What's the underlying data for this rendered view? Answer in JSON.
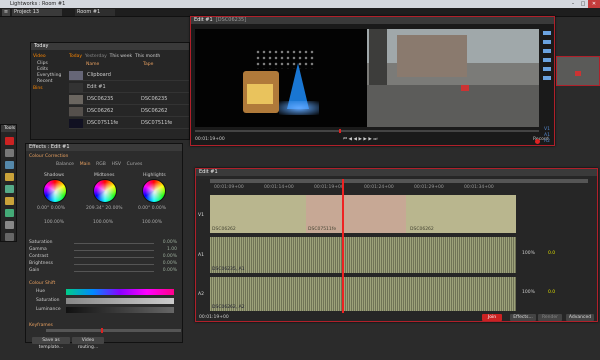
{
  "window": {
    "title": "Lightworks : Room #1",
    "minimize": "–",
    "maximize": "□",
    "close": "✕"
  },
  "project": {
    "name": "Project 13",
    "room": "Room #1"
  },
  "today": {
    "title": "Today",
    "tabs": [
      "Today",
      "Yesterday",
      "This week",
      "This month",
      "Cust..."
    ],
    "filters": [
      "Video",
      "Clips",
      "Edits",
      "Everything",
      "Recent",
      "Bins"
    ],
    "col_name": "Name",
    "col_tape": "Tape",
    "rows": [
      {
        "name": "Clipboard",
        "tape": ""
      },
      {
        "name": "Edit #1",
        "tape": ""
      },
      {
        "name": "DSC06235",
        "tape": "DSC06235"
      },
      {
        "name": "DSC06262",
        "tape": "DSC06262"
      },
      {
        "name": "DSC07511fe",
        "tape": "DSC07511fe"
      }
    ]
  },
  "effects": {
    "title": "Effects : Edit #1",
    "section_colour": "Colour Correction",
    "tabs": [
      "Balance",
      "Main",
      "RGB",
      "HSV",
      "Curves"
    ],
    "wheels": [
      {
        "name": "Shadows",
        "vals": "0.00°   0.00%",
        "pct": "100.00%"
      },
      {
        "name": "Midtones",
        "vals": "209.34°  20.00%",
        "pct": "100.00%"
      },
      {
        "name": "Highlights",
        "vals": "0.00°   0.00%",
        "pct": "100.00%"
      }
    ],
    "sliders": [
      {
        "name": "Saturation",
        "val": "0.00%"
      },
      {
        "name": "Gamma",
        "val": "1.00"
      },
      {
        "name": "Contrast",
        "val": "0.00%"
      },
      {
        "name": "Brightness",
        "val": "0.00%"
      },
      {
        "name": "Gain",
        "val": "0.00%"
      }
    ],
    "section_huesat": "Colour Shift",
    "hue_rows": [
      "Hue",
      "Saturation",
      "Luminance"
    ],
    "keyframes_label": "Keyframes",
    "save_template": "Save as template...",
    "video_routing": "Video routing..."
  },
  "tools": {
    "title": "Tools"
  },
  "viewer": {
    "title": "Edit #1",
    "clip": "[DSC06235]",
    "timecode": "00:01:19+00",
    "record": "Record",
    "tracks": [
      "V1",
      "A1",
      "A2"
    ]
  },
  "timeline": {
    "title": "Edit #1",
    "ruler": [
      "00:01:09+00",
      "00:01:14+00",
      "00:01:19+00",
      "00:01:24+00",
      "00:01:29+00",
      "00:01:34+00"
    ],
    "track_labels": [
      "V1",
      "A1",
      "A2"
    ],
    "clips_v": [
      "DSC06262",
      "DSC07511fe",
      "DSC06262"
    ],
    "clips_a1": "DSC06235, A1",
    "clips_a2": "DSC06262, A2",
    "levels": [
      "100%",
      "0.0",
      "100%",
      "0.0"
    ],
    "timecode": "00:01:19+00",
    "join": "Join",
    "effects": "Effects...",
    "render": "Render",
    "advanced": "Advanced"
  }
}
